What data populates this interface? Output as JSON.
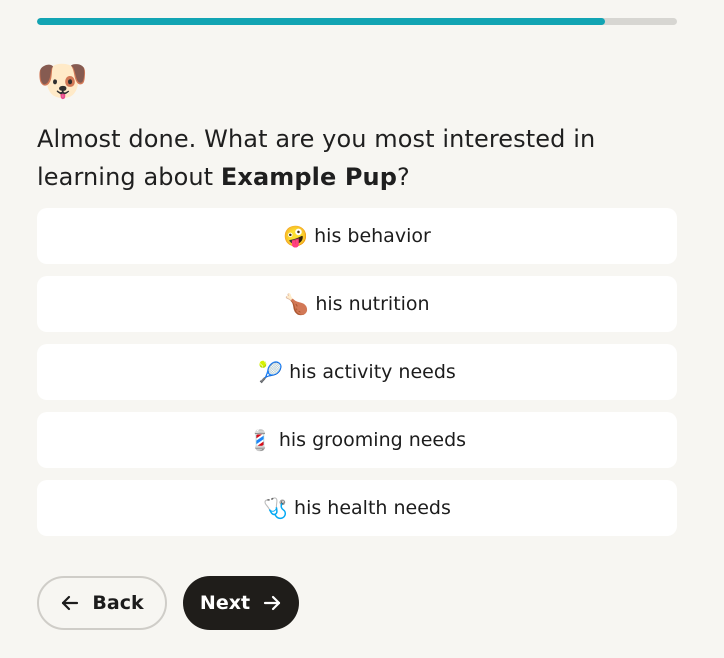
{
  "progress": {
    "fraction": 0.888
  },
  "mascot": {
    "emoji": "🐶"
  },
  "question": {
    "prefix": "Almost done. What are you most interested in learning about ",
    "pet_name": "Example Pup",
    "suffix": "?"
  },
  "options": [
    {
      "emoji": "🤪",
      "label": "his behavior"
    },
    {
      "emoji": "🍗",
      "label": "his nutrition"
    },
    {
      "emoji": "🎾",
      "label": "his activity needs"
    },
    {
      "emoji": "💈",
      "label": "his grooming needs"
    },
    {
      "emoji": "🩺",
      "label": "his health needs"
    }
  ],
  "buttons": {
    "back_label": "Back",
    "next_label": "Next"
  },
  "colors": {
    "accent": "#12a4b3",
    "primary_button": "#1f1d1a",
    "background": "#f7f6f2"
  }
}
